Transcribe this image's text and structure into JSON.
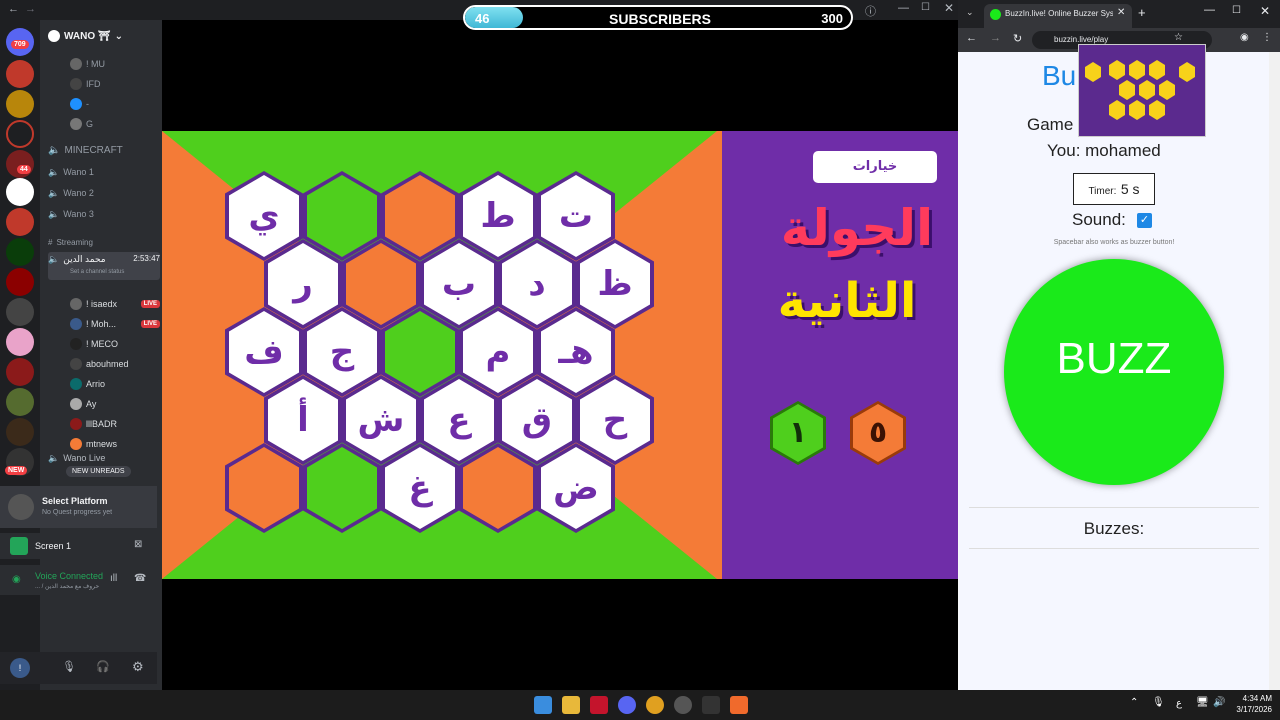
{
  "top_overlay": {
    "left_value": "46",
    "label": "SUBSCRIBERS",
    "right_value": "300",
    "progress": 0.15
  },
  "discord": {
    "server_name": "WANO ⛩",
    "server_badge_count": "709",
    "mentions_badge": "44",
    "new_badge": "NEW",
    "top_channels": [
      "! MU",
      "IFD",
      "-",
      "G"
    ],
    "category_minecraft": "MINECRAFT",
    "voice_channels": [
      "Wano 1",
      "Wano 2",
      "Wano 3"
    ],
    "category_streaming": "Streaming",
    "active_user": "محمد الدين",
    "active_time": "2:53:47",
    "set_status": "Set a channel status",
    "members": [
      {
        "name": "! isaedx",
        "live": true
      },
      {
        "name": "! Moh...",
        "live": true
      },
      {
        "name": "! MECO",
        "live": false
      },
      {
        "name": "abouhmed",
        "live": false
      },
      {
        "name": "Arrio",
        "live": false
      },
      {
        "name": "Ay",
        "live": false
      },
      {
        "name": "lllBADR",
        "live": false
      },
      {
        "name": "mtnews",
        "live": false
      }
    ],
    "wano_live": "Wano Live",
    "new_unreads": "NEW UNREADS",
    "select_platform": "Select Platform",
    "quest_progress": "No Quest progress yet",
    "screen_label": "Screen 1",
    "voice_connected": "Voice Connected",
    "voice_sub": "... / حروف مع محمد الدين",
    "user_initial": "!"
  },
  "game": {
    "side_button": "خيارات",
    "round_title_1": "الجولة",
    "round_title_2": "الثانية",
    "score_green": "١",
    "score_orange": "٥",
    "hexes": [
      {
        "c": "w",
        "t": "ي"
      },
      {
        "c": "g",
        "t": ""
      },
      {
        "c": "o",
        "t": ""
      },
      {
        "c": "w",
        "t": "ط"
      },
      {
        "c": "w",
        "t": "ت"
      },
      {
        "c": "w",
        "t": "ر"
      },
      {
        "c": "o",
        "t": ""
      },
      {
        "c": "w",
        "t": "ب"
      },
      {
        "c": "w",
        "t": "د"
      },
      {
        "c": "w",
        "t": "ظ"
      },
      {
        "c": "w",
        "t": "ف"
      },
      {
        "c": "w",
        "t": "ج"
      },
      {
        "c": "g",
        "t": ""
      },
      {
        "c": "w",
        "t": "م"
      },
      {
        "c": "w",
        "t": "هـ"
      },
      {
        "c": "w",
        "t": "أ"
      },
      {
        "c": "w",
        "t": "ش"
      },
      {
        "c": "w",
        "t": "ع"
      },
      {
        "c": "w",
        "t": "ق"
      },
      {
        "c": "w",
        "t": "ح"
      },
      {
        "c": "o",
        "t": ""
      },
      {
        "c": "g",
        "t": ""
      },
      {
        "c": "w",
        "t": "غ"
      },
      {
        "c": "o",
        "t": ""
      },
      {
        "c": "w",
        "t": "ض"
      }
    ]
  },
  "browser": {
    "tab_title": "BuzzIn.live! Online Buzzer Syste",
    "url": "buzzin.live/play",
    "heading": "Bu",
    "game_label": "Game",
    "you_label": "You: mohamed",
    "timer_label": "Timer:",
    "timer_value": "5 s",
    "sound_label": "Sound:",
    "sound_checked": true,
    "hint": "Spacebar also works as buzzer button!",
    "buzz_label": "BUZZ",
    "buzzes_label": "Buzzes:"
  },
  "taskbar": {
    "time": "4:34 AM",
    "date": "3/17/2026",
    "lang": "ع"
  },
  "colors": {
    "green": "#4fcf1d",
    "orange": "#f47b37",
    "purple": "#6f2da8",
    "buzz": "#1aea1a"
  }
}
